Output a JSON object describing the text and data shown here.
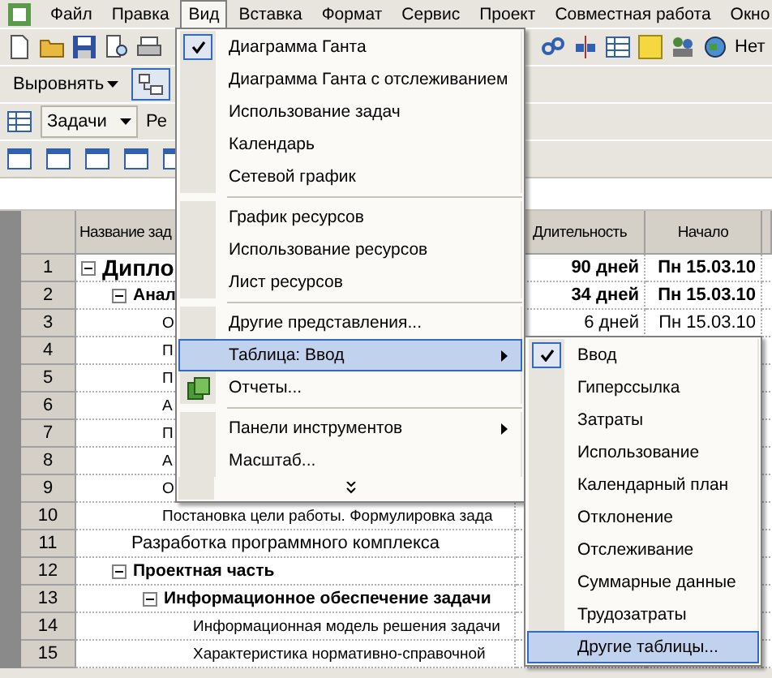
{
  "menu_bar": [
    {
      "label": "Файл",
      "selected": false
    },
    {
      "label": "Правка",
      "selected": false
    },
    {
      "label": "Вид",
      "selected": true
    },
    {
      "label": "Вставка",
      "selected": false
    },
    {
      "label": "Формат",
      "selected": false
    },
    {
      "label": "Сервис",
      "selected": false
    },
    {
      "label": "Проект",
      "selected": false
    },
    {
      "label": "Совместная работа",
      "selected": false
    },
    {
      "label": "Окно",
      "selected": false
    }
  ],
  "toolbars": {
    "group_text": "Нет",
    "align_button": "Выровнять",
    "outline_pressed": true,
    "view_dropdown": "Задачи",
    "cut_label": "Ре"
  },
  "view_menu": {
    "items": [
      {
        "kind": "item",
        "label": "Диаграмма Ганта",
        "checked": true,
        "selected": false,
        "submenu": false
      },
      {
        "kind": "item",
        "label": "Диаграмма Ганта с отслеживанием",
        "checked": false,
        "selected": false,
        "submenu": false
      },
      {
        "kind": "item",
        "label": "Использование задач",
        "checked": false,
        "selected": false,
        "submenu": false
      },
      {
        "kind": "item",
        "label": "Календарь",
        "checked": false,
        "selected": false,
        "submenu": false
      },
      {
        "kind": "item",
        "label": "Сетевой график",
        "checked": false,
        "selected": false,
        "submenu": false
      },
      {
        "kind": "separator"
      },
      {
        "kind": "item",
        "label": "График ресурсов",
        "checked": false,
        "selected": false,
        "submenu": false
      },
      {
        "kind": "item",
        "label": "Использование ресурсов",
        "checked": false,
        "selected": false,
        "submenu": false
      },
      {
        "kind": "item",
        "label": "Лист ресурсов",
        "checked": false,
        "selected": false,
        "submenu": false
      },
      {
        "kind": "separator"
      },
      {
        "kind": "item",
        "label": "Другие представления...",
        "checked": false,
        "selected": false,
        "submenu": false
      },
      {
        "kind": "item",
        "label": "Таблица: Ввод",
        "checked": false,
        "selected": true,
        "submenu": true
      },
      {
        "kind": "item",
        "label": "Отчеты...",
        "checked": false,
        "selected": false,
        "submenu": false,
        "icon": true
      },
      {
        "kind": "separator"
      },
      {
        "kind": "item",
        "label": "Панели инструментов",
        "checked": false,
        "selected": false,
        "submenu": true
      },
      {
        "kind": "item",
        "label": "Масштаб...",
        "checked": false,
        "selected": false,
        "submenu": false
      },
      {
        "kind": "expand"
      }
    ]
  },
  "table_submenu": {
    "items": [
      {
        "label": "Ввод",
        "checked": true,
        "selected": false
      },
      {
        "label": "Гиперссылка",
        "checked": false,
        "selected": false
      },
      {
        "label": "Затраты",
        "checked": false,
        "selected": false
      },
      {
        "label": "Использование",
        "checked": false,
        "selected": false
      },
      {
        "label": "Календарный план",
        "checked": false,
        "selected": false
      },
      {
        "label": "Отклонение",
        "checked": false,
        "selected": false
      },
      {
        "label": "Отслеживание",
        "checked": false,
        "selected": false
      },
      {
        "label": "Суммарные данные",
        "checked": false,
        "selected": false
      },
      {
        "label": "Трудозатраты",
        "checked": false,
        "selected": false
      },
      {
        "label": "Другие таблицы...",
        "checked": false,
        "selected": true
      }
    ]
  },
  "table": {
    "columns": [
      "Название зад",
      "Длительность",
      "Начало"
    ],
    "rows": [
      {
        "number": "1",
        "name": "Дипло",
        "duration": "90 дней",
        "start": "Пн 15.03.10",
        "expanded": true,
        "children": [
          {
            "number": "2",
            "name": "Анал",
            "duration": "34 дней",
            "start": "Пн 15.03.10",
            "expanded": true,
            "children": [
              {
                "number": "3",
                "name": "О",
                "duration": "6 дней",
                "start": "Пн 15.03.10"
              },
              {
                "number": "4",
                "name": "П"
              },
              {
                "number": "5",
                "name": "П"
              },
              {
                "number": "6",
                "name": "А"
              },
              {
                "number": "7",
                "name": "П"
              },
              {
                "number": "8",
                "name": "А"
              },
              {
                "number": "9",
                "name": "О"
              },
              {
                "number": "10",
                "name": "Постановка цели работы. Формулировка зада"
              }
            ]
          },
          {
            "number": "11",
            "name": "Разработка программного комплекса"
          },
          {
            "number": "12",
            "name": "Проектная часть",
            "expanded": true,
            "children": [
              {
                "number": "13",
                "name": "Информационное обеспечение задачи",
                "expanded": true,
                "children": [
                  {
                    "number": "14",
                    "name": "Информационная модель решения задачи"
                  },
                  {
                    "number": "15",
                    "name": "Характеристика нормативно-справочной"
                  }
                ]
              }
            ]
          }
        ]
      }
    ]
  }
}
